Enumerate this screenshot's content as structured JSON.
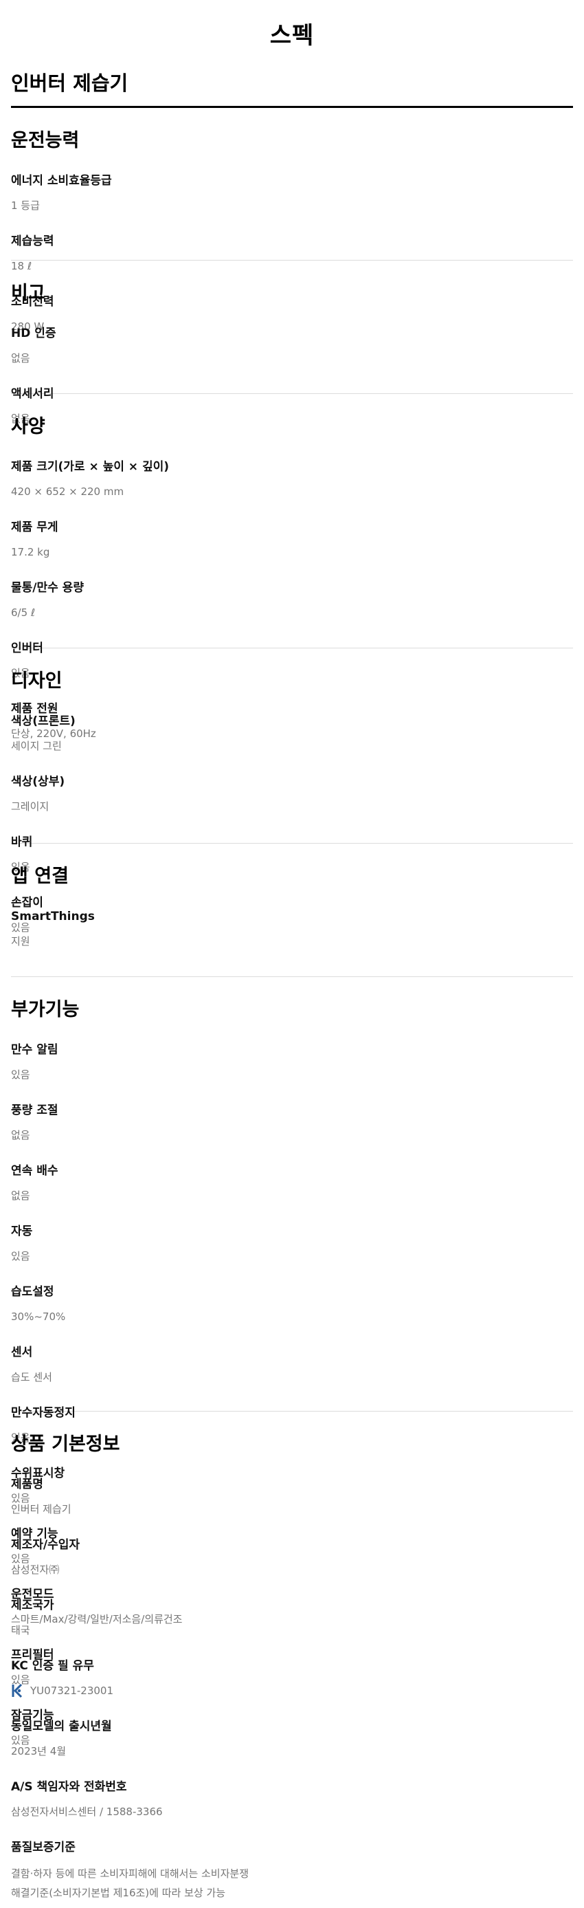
{
  "page_title": "스펙",
  "product_name": "인버터 제습기",
  "sections": [
    {
      "title": "운전능력",
      "items": [
        {
          "label": "에너지 소비효율등급",
          "value": "1 등급"
        },
        {
          "label": "제습능력",
          "value": "18 ℓ"
        },
        {
          "label": "소비전력",
          "value": "280 W"
        }
      ]
    },
    {
      "title": "비고",
      "items": [
        {
          "label": "HD 인증",
          "value": "없음"
        },
        {
          "label": "액세서리",
          "value": "없음"
        }
      ]
    },
    {
      "title": "사양",
      "items": [
        {
          "label": "제품 크기(가로 × 높이 × 깊이)",
          "value": "420 × 652 × 220 mm"
        },
        {
          "label": "제품 무게",
          "value": "17.2 kg"
        },
        {
          "label": "물통/만수 용량",
          "value": "6/5 ℓ"
        },
        {
          "label": "인버터",
          "value": "있음"
        },
        {
          "label": "제품 전원",
          "value": "단상, 220V, 60Hz"
        }
      ]
    },
    {
      "title": "디자인",
      "items": [
        {
          "label": "색상(프론트)",
          "value": "세이지 그린"
        },
        {
          "label": "색상(상부)",
          "value": "그레이지"
        },
        {
          "label": "바퀴",
          "value": "있음"
        },
        {
          "label": "손잡이",
          "value": "있음"
        }
      ]
    },
    {
      "title": "앱 연결",
      "items": [
        {
          "label": "SmartThings",
          "value": "지원"
        }
      ]
    },
    {
      "title": "부가기능",
      "items": [
        {
          "label": "만수 알림",
          "value": "있음"
        },
        {
          "label": "풍량 조절",
          "value": "없음"
        },
        {
          "label": "연속 배수",
          "value": "없음"
        },
        {
          "label": "자동",
          "value": "있음"
        },
        {
          "label": "습도설정",
          "value": "30%~70%"
        },
        {
          "label": "센서",
          "value": "습도 센서"
        },
        {
          "label": "만수자동정지",
          "value": "있음"
        },
        {
          "label": "수위표시창",
          "value": "있음"
        },
        {
          "label": "예약 기능",
          "value": "있음"
        },
        {
          "label": "운전모드",
          "value": "스마트/Max/강력/일반/저소음/의류건조"
        },
        {
          "label": "프리필터",
          "value": "있음"
        },
        {
          "label": "잠금기능",
          "value": "있음"
        }
      ]
    },
    {
      "title": "상품 기본정보",
      "items": [
        {
          "label": "제품명",
          "value": "인버터 제습기"
        },
        {
          "label": "제조자/수입자",
          "value": "삼성전자㈜"
        },
        {
          "label": "제조국가",
          "value": "태국"
        },
        {
          "label": "KC 인증 필 유무",
          "value": "YU07321-23001",
          "icon": "kc-mark-icon"
        },
        {
          "label": "동일모델의 출시년월",
          "value": "2023년 4월"
        },
        {
          "label": "A/S 책임자와 전화번호",
          "value": "삼성전자서비스센터 / 1588-3366"
        },
        {
          "label": "품질보증기준",
          "value_lines": [
            "결함·하자 등에 따른 소비자피해에 대해서는 소비자분쟁",
            "해결기준(소비자기본법 제16조)에 따라 보상 가능"
          ]
        }
      ]
    }
  ]
}
